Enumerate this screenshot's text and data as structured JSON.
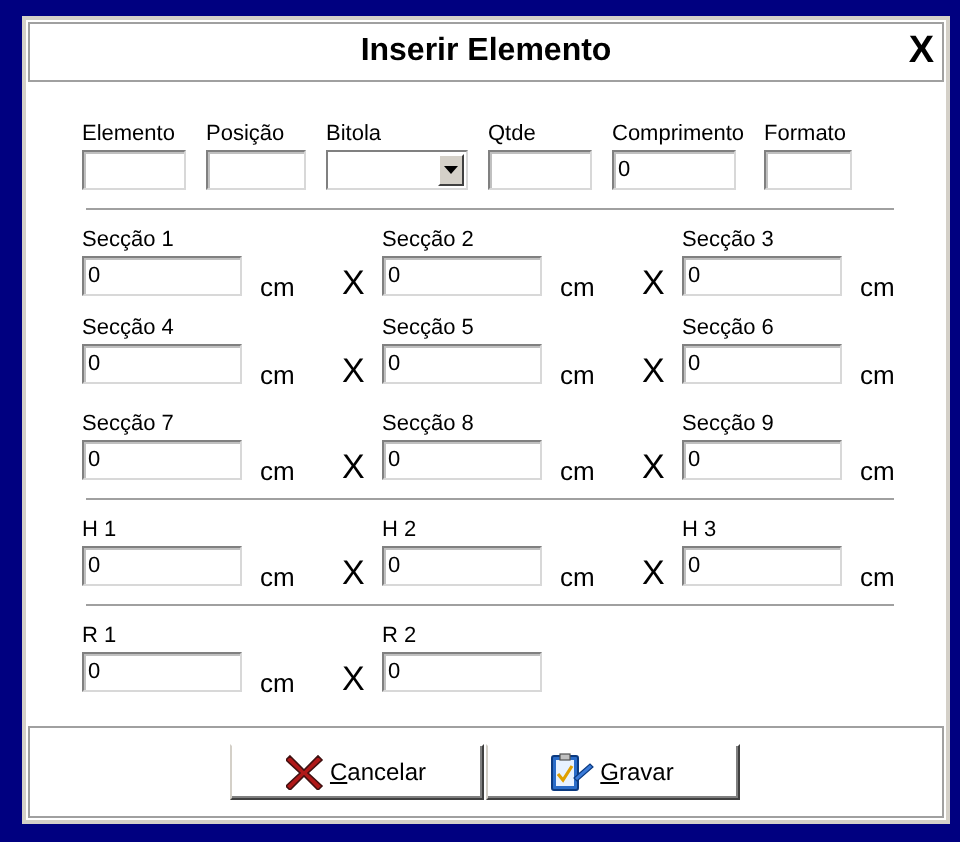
{
  "window": {
    "title": "Inserir Elemento",
    "close": "X"
  },
  "top_fields": [
    {
      "label": "Elemento",
      "kind": "text"
    },
    {
      "label": "Posição",
      "kind": "text"
    },
    {
      "label": "Bitola",
      "kind": "combo"
    },
    {
      "label": "Qtde",
      "kind": "text"
    },
    {
      "label": "Comprimento",
      "kind": "text",
      "value": "0"
    },
    {
      "label": "Formato",
      "kind": "text"
    }
  ],
  "groups": [
    {
      "rows": [
        {
          "items": [
            {
              "label": "Secção 1",
              "value": "0",
              "unit": "cm",
              "separator": "X"
            },
            {
              "label": "Secção 2",
              "value": "0",
              "unit": "cm",
              "separator": "X"
            },
            {
              "label": "Secção 3",
              "value": "0",
              "unit": "cm"
            }
          ]
        },
        {
          "items": [
            {
              "label": "Secção 4",
              "value": "0",
              "unit": "cm",
              "separator": "X"
            },
            {
              "label": "Secção 5",
              "value": "0",
              "unit": "cm",
              "separator": "X"
            },
            {
              "label": "Secção 6",
              "value": "0",
              "unit": "cm"
            }
          ]
        },
        {
          "items": [
            {
              "label": "Secção 7",
              "value": "0",
              "unit": "cm",
              "separator": "X"
            },
            {
              "label": "Secção 8",
              "value": "0",
              "unit": "cm",
              "separator": "X"
            },
            {
              "label": "Secção 9",
              "value": "0",
              "unit": "cm"
            }
          ]
        }
      ]
    },
    {
      "rows": [
        {
          "items": [
            {
              "label": "H 1",
              "value": "0",
              "unit": "cm",
              "separator": "X"
            },
            {
              "label": "H 2",
              "value": "0",
              "unit": "cm",
              "separator": "X"
            },
            {
              "label": "H 3",
              "value": "0",
              "unit": "cm"
            }
          ]
        }
      ]
    },
    {
      "rows": [
        {
          "items": [
            {
              "label": "R 1",
              "value": "0",
              "unit": "cm",
              "separator": "X"
            },
            {
              "label": "R 2",
              "value": "0"
            }
          ]
        }
      ]
    }
  ],
  "buttons": [
    {
      "label": "Cancelar",
      "kind": "cancel"
    },
    {
      "label": "Gravar",
      "kind": "save"
    }
  ]
}
